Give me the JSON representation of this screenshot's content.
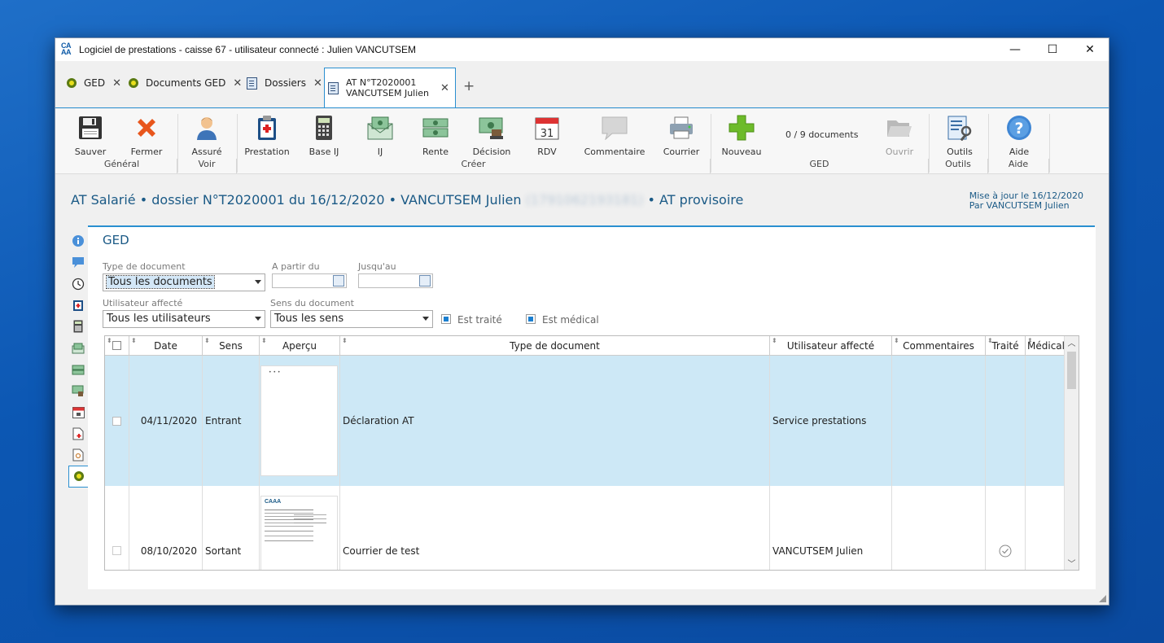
{
  "window": {
    "title": "Logiciel de prestations - caisse 67 - utilisateur connecté : Julien VANCUTSEM",
    "logo_text": "CA\nAA",
    "controls": [
      "—",
      "☐",
      "✕"
    ]
  },
  "tabs": [
    {
      "label": "GED",
      "icon": "ged-dot-icon"
    },
    {
      "label": "Documents GED",
      "icon": "ged-dot-icon"
    },
    {
      "label": "Dossiers",
      "icon": "folder-book-icon"
    },
    {
      "label_line1": "AT N°T2020001",
      "label_line2": "VANCUTSEM Julien",
      "icon": "folder-book-icon",
      "active": true
    }
  ],
  "tab_close": "✕",
  "tab_add": "+",
  "ribbon": {
    "buttons": {
      "sauver": "Sauver",
      "fermer": "Fermer",
      "assure": "Assuré",
      "prestation": "Prestation",
      "base_ij": "Base IJ",
      "ij": "IJ",
      "rente": "Rente",
      "decision": "Décision",
      "rdv": "RDV",
      "commentaire": "Commentaire",
      "courrier": "Courrier",
      "nouveau": "Nouveau",
      "ouvrir": "Ouvrir",
      "outils": "Outils",
      "aide": "Aide"
    },
    "doc_count": "0 / 9 documents",
    "groups": {
      "general": "Général",
      "voir": "Voir",
      "creer": "Créer",
      "ged": "GED",
      "outils": "Outils",
      "aide": "Aide"
    },
    "rdv_day": "31"
  },
  "header": {
    "part1": "AT Salarié • dossier N°T2020001 du 16/12/2020 • VANCUTSEM Julien",
    "blurred_id": "(1791062193181)",
    "part2": "• AT provisoire",
    "updated_line1": "Mise à jour le 16/12/2020",
    "updated_line2": "Par VANCUTSEM Julien"
  },
  "ged": {
    "title": "GED",
    "filters": {
      "type_label": "Type de document",
      "type_value": "Tous les documents",
      "from_label": "A partir du",
      "to_label": "Jusqu'au",
      "user_label": "Utilisateur affecté",
      "user_value": "Tous les utilisateurs",
      "sens_label": "Sens du document",
      "sens_value": "Tous les sens",
      "traite_label": "Est traité",
      "medical_label": "Est médical"
    },
    "columns": [
      "Date",
      "Sens",
      "Aperçu",
      "Type de document",
      "Utilisateur affecté",
      "Commentaires",
      "Traité",
      "Médical"
    ],
    "rows": [
      {
        "date": "04/11/2020",
        "sens": "Entrant",
        "type": "Déclaration AT",
        "user": "Service prestations",
        "traite": false,
        "selected": true
      },
      {
        "date": "08/10/2020",
        "sens": "Sortant",
        "type": "Courrier de test",
        "user": "VANCUTSEM Julien",
        "traite": true,
        "selected": false
      }
    ],
    "preview_logo": "CAAA",
    "preview_dots": "• • •"
  },
  "colors": {
    "accent": "#2a8fd0",
    "title_blue": "#1b5a86",
    "selected_row": "#cde8f6"
  }
}
